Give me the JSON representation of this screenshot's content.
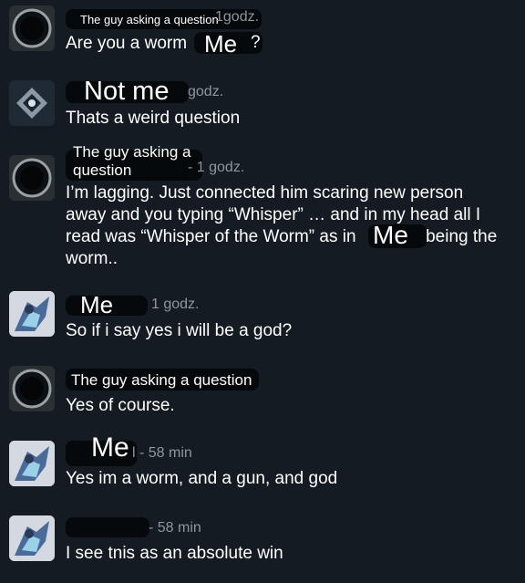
{
  "messages": [
    {
      "author_label": "The guy asking a question",
      "meta_suffix": "1godz.",
      "text_prefix": "Are you a worm",
      "overlay": "Me",
      "text_suffix": "?"
    },
    {
      "author_label": "Not me",
      "meta_suffix": "godz.",
      "text": "Thats a weird question"
    },
    {
      "author_label": "The guy asking a question",
      "meta_suffix": "- 1 godz.",
      "text_line1": "I’m lagging. Just connected him scaring new person",
      "text_line2": "away and you typing “Whisper” … and in my head all I",
      "text_line3_prefix": "read was “Whisper of the Worm” as in",
      "text_line3_overlay": "Me",
      "text_line3_suffix": "being the",
      "text_line4": "worm.."
    },
    {
      "author_label": "Me",
      "meta_suffix": "1 godz.",
      "text": "So if i say yes i will be a god?"
    },
    {
      "author_label": "The guy asking a question",
      "text": "Yes of course."
    },
    {
      "author_label": "Me",
      "meta_suffix": "l - 58 min",
      "text": "Yes im a worm, and a gun, and god"
    },
    {
      "meta_suffix": "- 58 min",
      "text": "I see tnis as an absolute win"
    }
  ],
  "icons": {
    "ring_avatar": "dark-ring-avatar-icon",
    "ghost_avatar": "ghost-shell-avatar-icon",
    "art_avatar": "character-art-avatar-icon"
  }
}
